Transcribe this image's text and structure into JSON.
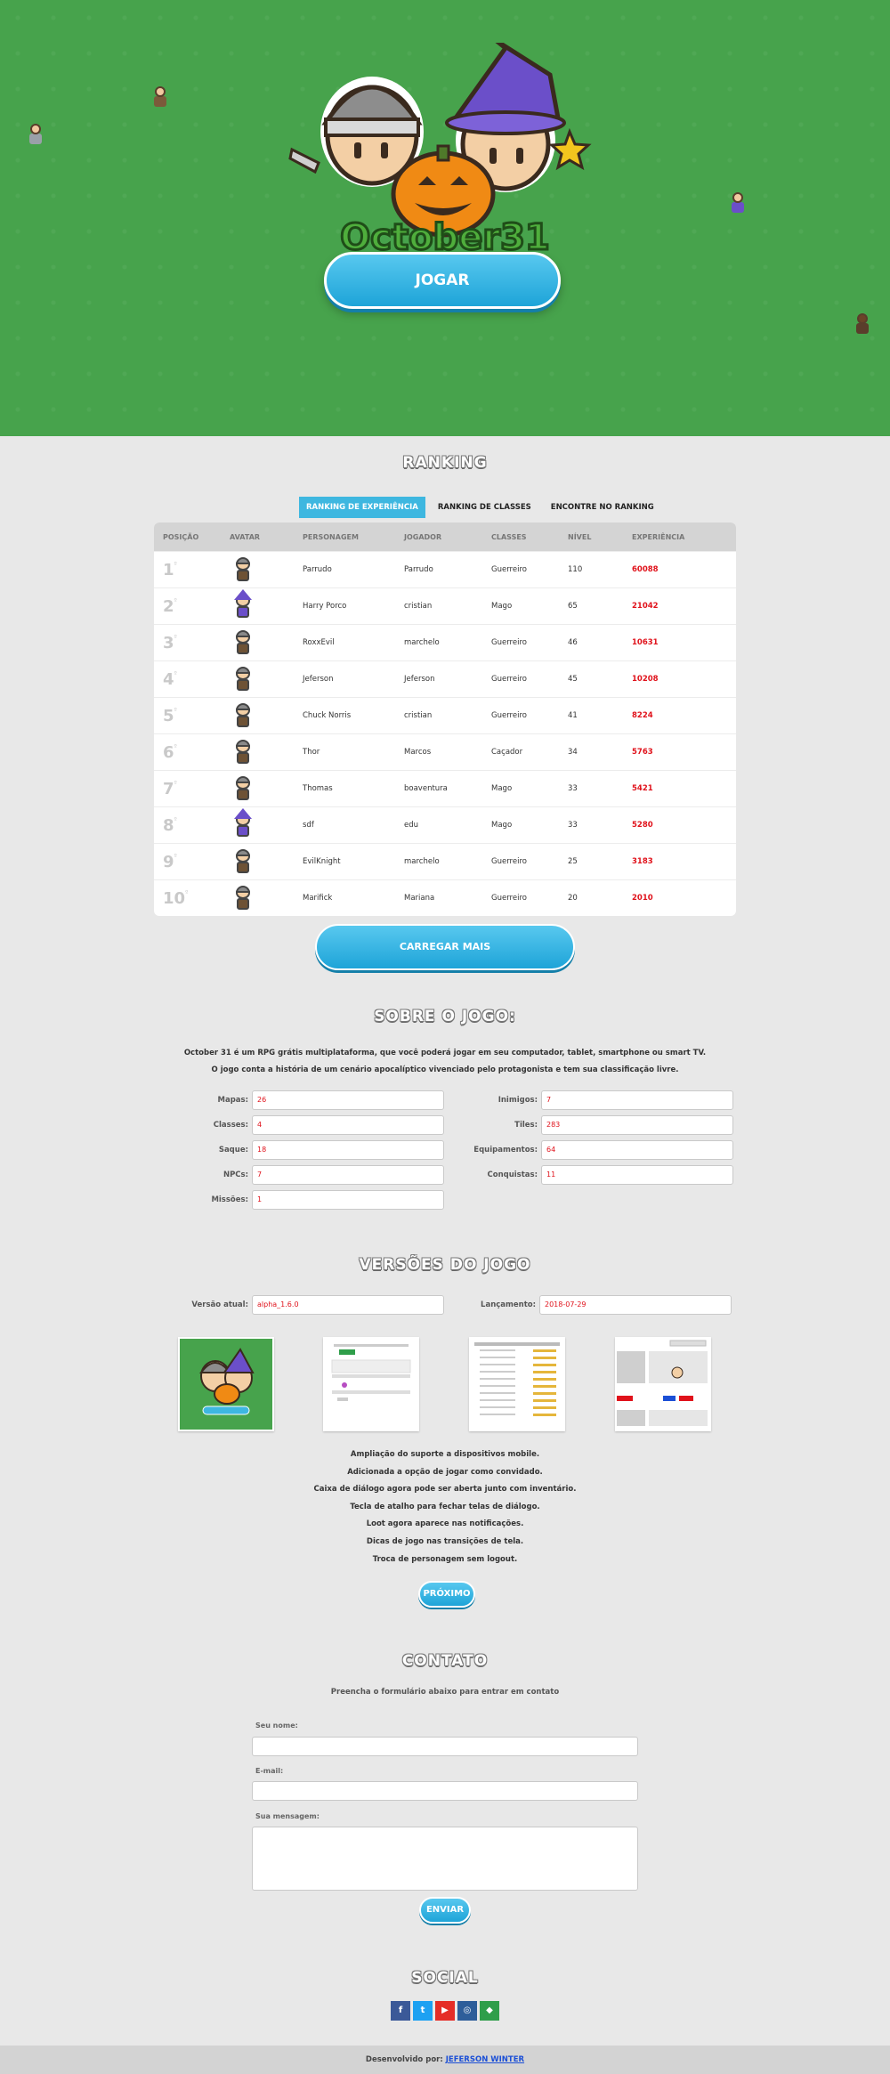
{
  "hero": {
    "logo_text": "October31",
    "play_label": "JOGAR"
  },
  "ranking": {
    "title": "RANKING",
    "tabs": [
      "RANKING DE EXPERIÊNCIA",
      "RANKING DE CLASSES",
      "ENCONTRE NO RANKING"
    ],
    "headers": [
      "POSIÇÃO",
      "AVATAR",
      "PERSONAGEM",
      "JOGADOR",
      "CLASSES",
      "NÍVEL",
      "EXPERIÊNCIA"
    ],
    "rows": [
      {
        "pos": "1",
        "suf": "º",
        "avatar": "warrior",
        "personagem": "Parrudo",
        "jogador": "Parrudo",
        "classe": "Guerreiro",
        "nivel": "110",
        "exp": "60088"
      },
      {
        "pos": "2",
        "suf": "º",
        "avatar": "wizard",
        "personagem": "Harry Porco",
        "jogador": "cristian",
        "classe": "Mago",
        "nivel": "65",
        "exp": "21042"
      },
      {
        "pos": "3",
        "suf": "º",
        "avatar": "warrior",
        "personagem": "RoxxEvil",
        "jogador": "marchelo",
        "classe": "Guerreiro",
        "nivel": "46",
        "exp": "10631"
      },
      {
        "pos": "4",
        "suf": "º",
        "avatar": "warrior",
        "personagem": "Jeferson",
        "jogador": "Jeferson",
        "classe": "Guerreiro",
        "nivel": "45",
        "exp": "10208"
      },
      {
        "pos": "5",
        "suf": "º",
        "avatar": "warrior",
        "personagem": "Chuck Norris",
        "jogador": "cristian",
        "classe": "Guerreiro",
        "nivel": "41",
        "exp": "8224"
      },
      {
        "pos": "6",
        "suf": "º",
        "avatar": "warrior",
        "personagem": "Thor",
        "jogador": "Marcos",
        "classe": "Caçador",
        "nivel": "34",
        "exp": "5763"
      },
      {
        "pos": "7",
        "suf": "º",
        "avatar": "warrior",
        "personagem": "Thomas",
        "jogador": "boaventura",
        "classe": "Mago",
        "nivel": "33",
        "exp": "5421"
      },
      {
        "pos": "8",
        "suf": "º",
        "avatar": "wizard",
        "personagem": "sdf",
        "jogador": "edu",
        "classe": "Mago",
        "nivel": "33",
        "exp": "5280"
      },
      {
        "pos": "9",
        "suf": "º",
        "avatar": "warrior",
        "personagem": "EvilKnight",
        "jogador": "marchelo",
        "classe": "Guerreiro",
        "nivel": "25",
        "exp": "3183"
      },
      {
        "pos": "10",
        "suf": "º",
        "avatar": "warrior",
        "personagem": "Marifick",
        "jogador": "Mariana",
        "classe": "Guerreiro",
        "nivel": "20",
        "exp": "2010"
      }
    ],
    "load_more": "CARREGAR MAIS"
  },
  "sobre": {
    "title": "SOBRE O JOGO:",
    "line1": "October 31 é um RPG grátis multiplataforma, que você poderá jogar em seu computador, tablet, smartphone ou smart TV.",
    "line2": "O jogo conta a história de um cenário apocalíptico vivenciado pelo protagonista e tem sua classificação livre.",
    "left": [
      {
        "label": "Mapas:",
        "value": "26"
      },
      {
        "label": "Classes:",
        "value": "4"
      },
      {
        "label": "Saque:",
        "value": "18"
      },
      {
        "label": "NPCs:",
        "value": "7"
      },
      {
        "label": "Missões:",
        "value": "1"
      }
    ],
    "right": [
      {
        "label": "Inimigos:",
        "value": "7"
      },
      {
        "label": "Tiles:",
        "value": "283"
      },
      {
        "label": "Equipamentos:",
        "value": "64"
      },
      {
        "label": "Conquistas:",
        "value": "11"
      }
    ]
  },
  "versoes": {
    "title": "VERSÕES DO JOGO",
    "current_label": "Versão atual:",
    "current_value": "alpha_1.6.0",
    "launch_label": "Lançamento:",
    "launch_value": "2018-07-29",
    "changes": [
      "Ampliação do suporte a dispositivos mobile.",
      "Adicionada a opção de jogar como convidado.",
      "Caixa de diálogo agora pode ser aberta junto com inventário.",
      "Tecla de atalho para fechar telas de diálogo.",
      "Loot agora aparece nas notificações.",
      "Dicas de jogo nas transições de tela.",
      "Troca de personagem sem logout."
    ],
    "next_label": "PRÓXIMO"
  },
  "contato": {
    "title": "CONTATO",
    "subtitle": "Preencha o formulário abaixo para entrar em contato",
    "name_label": "Seu nome:",
    "email_label": "E-mail:",
    "message_label": "Sua mensagem:",
    "send_label": "ENVIAR"
  },
  "social": {
    "title": "SOCIAL",
    "icons": [
      {
        "name": "facebook",
        "glyph": "f",
        "color": "#3b5998"
      },
      {
        "name": "twitter",
        "glyph": "t",
        "color": "#1da1f2"
      },
      {
        "name": "youtube",
        "glyph": "▶",
        "color": "#e52d27"
      },
      {
        "name": "instagram",
        "glyph": "◎",
        "color": "#2e5e9a"
      },
      {
        "name": "gamejolt",
        "glyph": "◆",
        "color": "#2f9e4a"
      }
    ]
  },
  "footer": {
    "prefix": "Desenvolvido por:",
    "author": "JEFERSON WINTER"
  }
}
